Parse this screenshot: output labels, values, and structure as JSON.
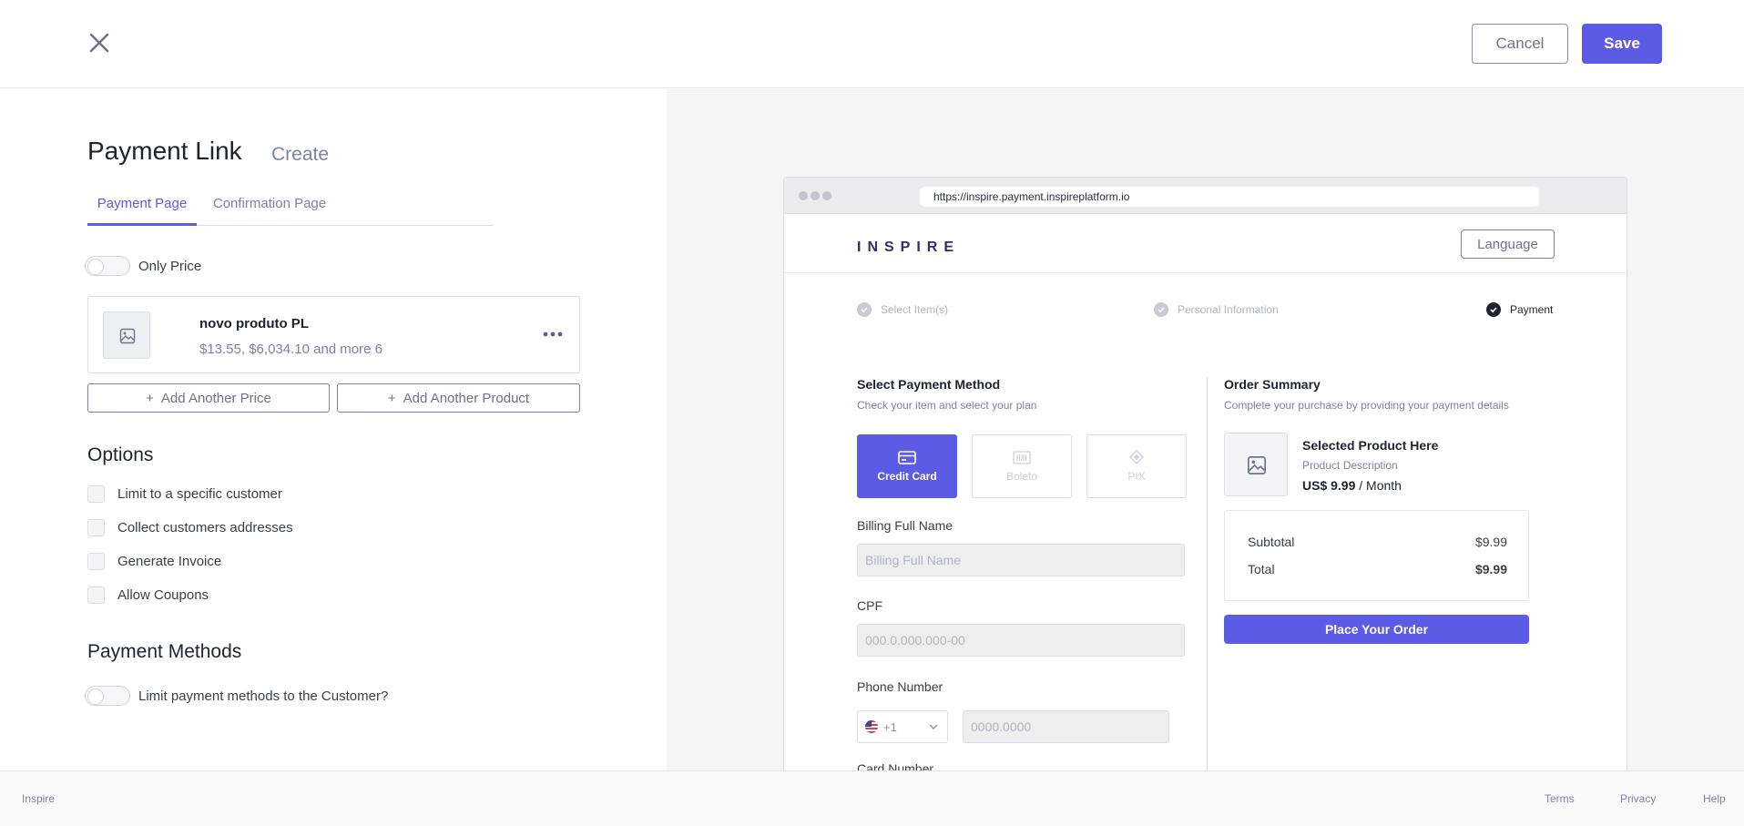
{
  "header": {
    "cancel_label": "Cancel",
    "save_label": "Save",
    "close_icon": "close-icon"
  },
  "editor": {
    "title": "Payment Link",
    "subtitle": "Create",
    "tabs": [
      {
        "label": "Payment Page",
        "active": true
      },
      {
        "label": "Confirmation Page",
        "active": false
      }
    ],
    "only_price_label": "Only Price",
    "product": {
      "name": "novo produto PL",
      "prices": "$13.55, $6,034.10 and more 6"
    },
    "add_price_label": "Add Another Price",
    "add_product_label": "Add Another Product",
    "options_title": "Options",
    "options": [
      {
        "label": "Limit to a specific customer",
        "checked": false
      },
      {
        "label": "Collect customers addresses",
        "checked": false
      },
      {
        "label": "Generate Invoice",
        "checked": false
      },
      {
        "label": "Allow Coupons",
        "checked": false
      }
    ],
    "payment_methods_title": "Payment Methods",
    "limit_methods_label": "Limit payment methods to the Customer?"
  },
  "preview": {
    "url": "https://inspire.payment.inspireplatform.io",
    "brand": "INSPIRE",
    "language_label": "Language",
    "steps": [
      {
        "label": "Select Item(s)",
        "state": "done"
      },
      {
        "label": "Personal Information",
        "state": "done"
      },
      {
        "label": "Payment",
        "state": "current"
      }
    ],
    "payment": {
      "title": "Select Payment Method",
      "subtitle": "Check your item and select your plan",
      "methods": [
        {
          "label": "Credit Card",
          "icon": "credit-card-icon",
          "active": true
        },
        {
          "label": "Boleto",
          "icon": "barcode-icon",
          "active": false
        },
        {
          "label": "PIX",
          "icon": "pix-icon",
          "active": false
        }
      ],
      "billing_label": "Billing Full Name",
      "billing_placeholder": "Billing Full Name",
      "cpf_label": "CPF",
      "cpf_placeholder": "000.0.000.000-00",
      "phone_label": "Phone Number",
      "phone_code": "+1",
      "phone_placeholder": "0000.0000",
      "card_label": "Card Number"
    },
    "summary": {
      "title": "Order Summary",
      "subtitle": "Complete your purchase by providing your payment details",
      "product_name": "Selected Product Here",
      "product_desc": "Product Description",
      "price": "US$ 9.99",
      "period": "/ Month",
      "subtotal_label": "Subtotal",
      "subtotal_value": "$9.99",
      "total_label": "Total",
      "total_value": "$9.99",
      "place_order_label": "Place Your Order"
    }
  },
  "footer": {
    "brand": "Inspire",
    "links": [
      "Terms",
      "Privacy",
      "Help"
    ]
  },
  "colors": {
    "accent": "#5b5be6",
    "muted": "#7c82a8"
  }
}
